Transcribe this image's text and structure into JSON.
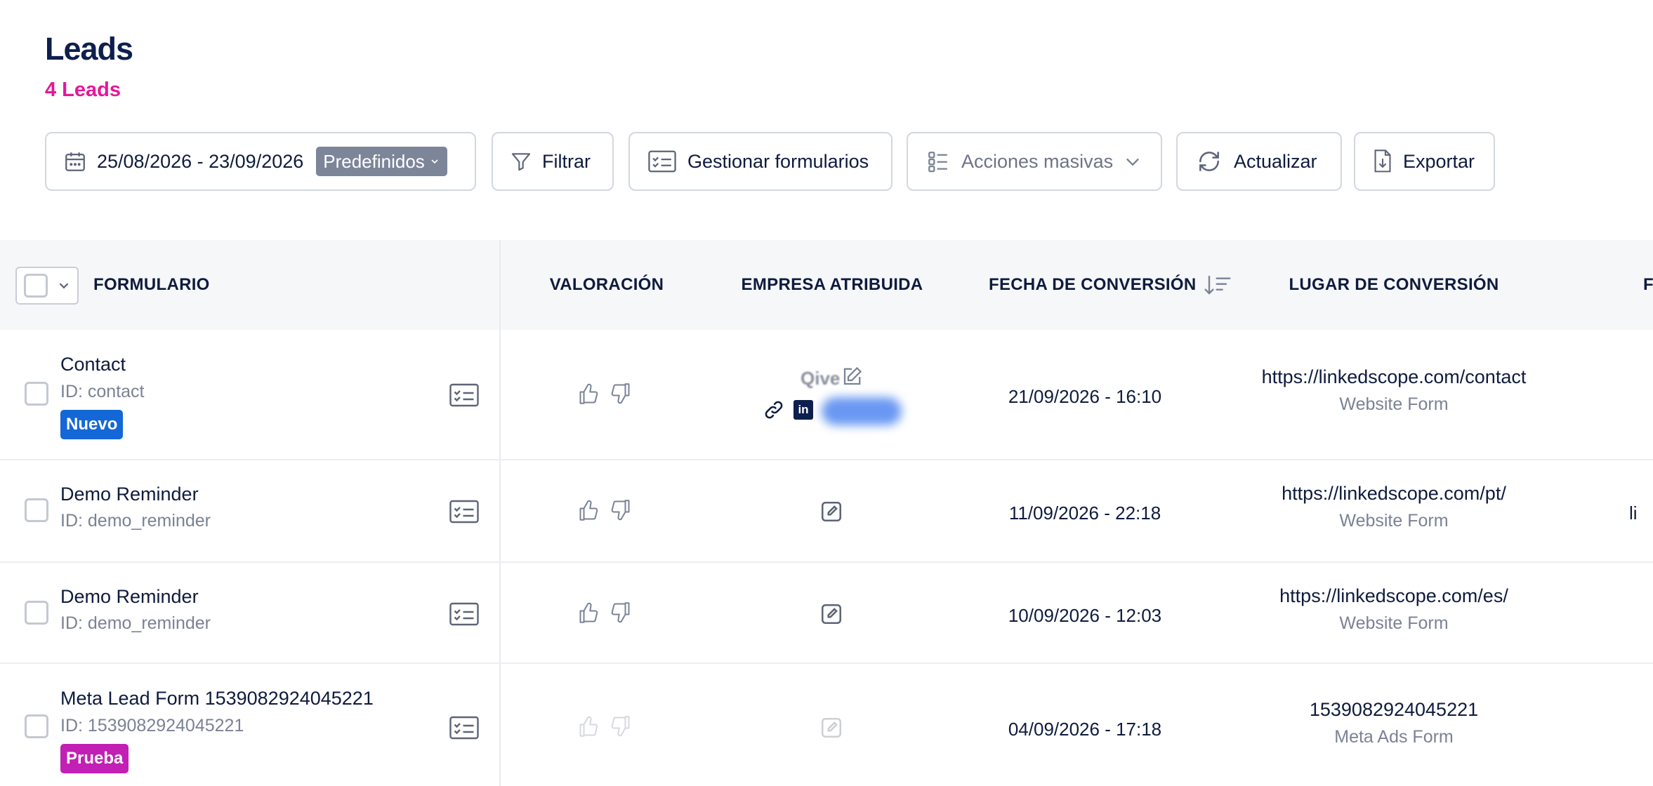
{
  "page": {
    "title": "Leads",
    "count_label": "4 Leads"
  },
  "toolbar": {
    "date_range": "25/08/2026 - 23/09/2026",
    "presets_label": "Predefinidos",
    "filter_label": "Filtrar",
    "manage_forms_label": "Gestionar formularios",
    "bulk_actions_label": "Acciones masivas",
    "refresh_label": "Actualizar",
    "export_label": "Exportar"
  },
  "table": {
    "columns": {
      "form": "FORMULARIO",
      "rating": "VALORACIÓN",
      "company": "EMPRESA ATRIBUIDA",
      "conversion_date": "FECHA DE CONVERSIÓN",
      "conversion_place": "LUGAR DE CONVERSIÓN",
      "next_partial": "F"
    },
    "rows": [
      {
        "form_name": "Contact",
        "form_id": "ID: contact",
        "tag": "Nuevo",
        "company": "Qive",
        "conversion_date": "21/09/2026 - 16:10",
        "place_url": "https://linkedscope.com/contact",
        "place_source": "Website Form"
      },
      {
        "form_name": "Demo Reminder",
        "form_id": "ID: demo_reminder",
        "conversion_date": "11/09/2026 - 22:18",
        "place_url": "https://linkedscope.com/pt/",
        "place_source": "Website Form",
        "next_partial": "li"
      },
      {
        "form_name": "Demo Reminder",
        "form_id": "ID: demo_reminder",
        "conversion_date": "10/09/2026 - 12:03",
        "place_url": "https://linkedscope.com/es/",
        "place_source": "Website Form"
      },
      {
        "form_name": "Meta Lead Form 1539082924045221",
        "form_id": "ID: 1539082924045221",
        "tag": "Prueba",
        "conversion_date": "04/09/2026 - 17:18",
        "place_url": "1539082924045221",
        "place_source": "Meta Ads Form"
      }
    ]
  },
  "colors": {
    "title": "#0d1f4e",
    "count": "#e5179a",
    "tag_nuevo": "#1467d6",
    "tag_prueba": "#c21fb4",
    "preset_badge": "#7d8599"
  },
  "icons": [
    "calendar-icon",
    "chevron-down-icon",
    "filter-icon",
    "form-list-icon",
    "checklist-icon",
    "refresh-icon",
    "export-file-icon",
    "sort-icon",
    "thumbs-up-icon",
    "thumbs-down-icon",
    "edit-icon",
    "link-icon",
    "linkedin-icon"
  ]
}
